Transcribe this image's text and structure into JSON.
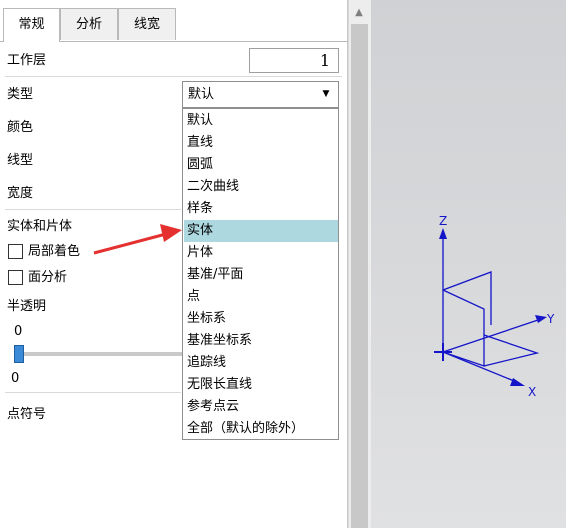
{
  "tabs": [
    {
      "label": "常规"
    },
    {
      "label": "分析"
    },
    {
      "label": "线宽"
    }
  ],
  "fields": {
    "work_layer_label": "工作层",
    "work_layer_value": "1",
    "type_label": "类型",
    "type_selected": "默认",
    "color_label": "颜色",
    "linetype_label": "线型",
    "width_label": "宽度"
  },
  "solid_section": {
    "title": "实体和片体",
    "local_shading_label": "局部着色",
    "face_analysis_label": "面分析"
  },
  "translucency": {
    "title": "半透明",
    "value_top": "0",
    "value_bottom": "0",
    "level": 0
  },
  "point_symbol_label": "点符号",
  "dropdown": {
    "options": [
      "默认",
      "直线",
      "圆弧",
      "二次曲线",
      "样条",
      "实体",
      "片体",
      "基准/平面",
      "点",
      "坐标系",
      "基准坐标系",
      "追踪线",
      "无限长直线",
      "参考点云",
      "全部（默认的除外）"
    ],
    "highlighted": "实体"
  },
  "triad": {
    "x_label": "X",
    "y_label": "Y",
    "z_label": "Z",
    "color": "#1414c8"
  },
  "colors": {
    "highlight": "#add8e0",
    "annotation_arrow": "#e53030"
  }
}
